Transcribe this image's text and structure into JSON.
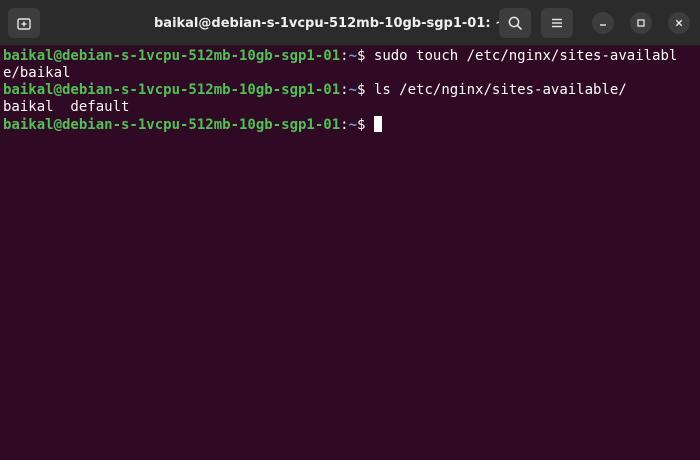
{
  "window": {
    "title": "baikal@debian-s-1vcpu-512mb-10gb-sgp1-01: ~"
  },
  "colors": {
    "background": "#300a24",
    "titlebar": "#2b2b2b",
    "prompt_user": "#4ec254",
    "prompt_path": "#729fcf",
    "text": "#ffffff"
  },
  "icons": {
    "new_tab": "new-tab-icon",
    "search": "search-icon",
    "menu": "hamburger-menu-icon",
    "minimize": "minimize-icon",
    "maximize": "maximize-icon",
    "close": "close-icon"
  },
  "terminal": {
    "prompt": {
      "user_host": "baikal@debian-s-1vcpu-512mb-10gb-sgp1-01",
      "colon": ":",
      "path": "~",
      "symbol": "$"
    },
    "lines": [
      {
        "type": "prompt",
        "command": " sudo touch /etc/nginx/sites-availabl"
      },
      {
        "type": "output",
        "text": "e/baikal"
      },
      {
        "type": "prompt",
        "command": " ls /etc/nginx/sites-available/"
      },
      {
        "type": "output",
        "text": "baikal  default"
      },
      {
        "type": "prompt",
        "command": " "
      }
    ]
  }
}
